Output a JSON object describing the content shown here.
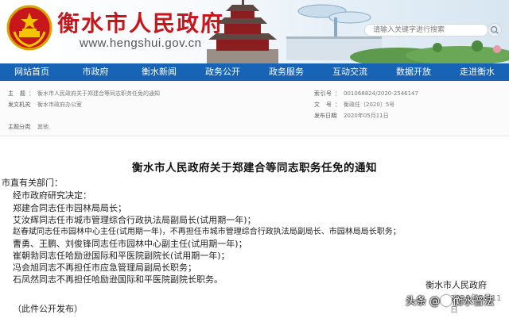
{
  "header": {
    "site_title": "衡水市人民政府",
    "site_url": "www.hengshui.gov.cn",
    "search_placeholder": "请输入关键字进行搜索"
  },
  "nav": {
    "items": [
      "网站首页",
      "市政府",
      "衡水新闻",
      "政务公开",
      "政务服务",
      "互动交流",
      "数据开放",
      "走进衡水"
    ]
  },
  "meta": {
    "fields": [
      {
        "key": "主题",
        "value": "衡水市人民政府关于郑建合等同志职务任免的通知"
      },
      {
        "key": "发文机关",
        "value": "衡水市政府办公室"
      },
      {
        "key": "主题分类",
        "value": "其他"
      },
      {
        "key": "索引号",
        "value": "001068824/2020-2546147"
      },
      {
        "key": "文号",
        "value": "衡政任〔2020〕5号"
      },
      {
        "key": "发布日期",
        "value": "2020年05月11日"
      }
    ]
  },
  "article": {
    "title": "衡水市人民政府关于郑建合等同志职务任免的通知",
    "lines": [
      "市直有关部门：",
      "经市政府研究决定：",
      "郑建合同志任市园林局局长；",
      "艾汝辉同志任市城市管理综合行政执法局副局长(试用期一年)；",
      "赵春斌同志任市园林中心主任(试用期一年)，不再担任市城市管理综合行政执法局副局长、市园林局局长职务；",
      "曹勇、王鹏、刘俊锋同志任市园林中心副主任(试用期一年)；",
      "崔朝勃同志任哈励逊国际和平医院副院长(试用期一年)；",
      "冯会旭同志不再担任市应急管理局副局长职务；",
      "石凤然同志不再担任哈励逊国际和平医院副院长职务。"
    ],
    "signature": "衡水市人民政府",
    "date": "2020年5月11日",
    "note": "（此件公开发布）"
  },
  "watermark": {
    "text_before": "头条 @",
    "text_after": "衡水普法"
  },
  "colors": {
    "nav_bg": "#1763b5",
    "title_red": "#c8161d"
  }
}
